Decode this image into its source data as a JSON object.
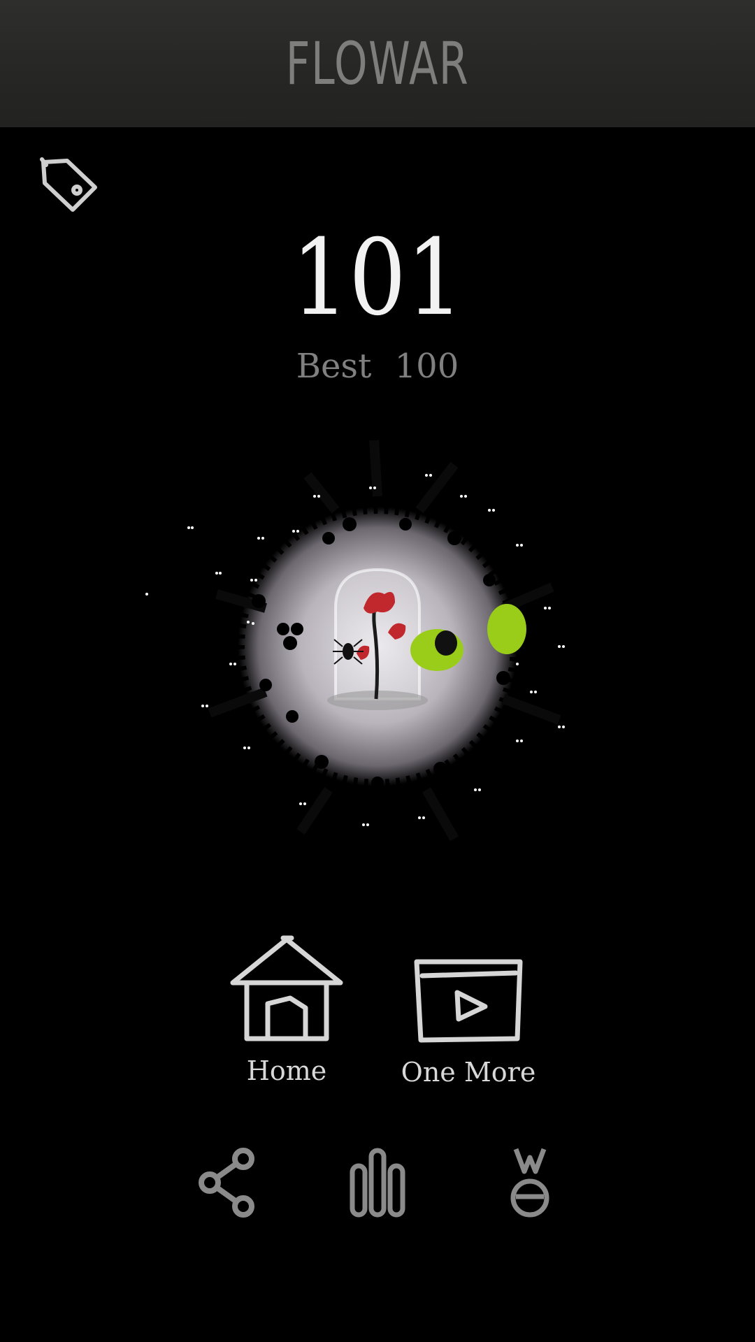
{
  "header": {
    "title": "FLOWAR"
  },
  "score": {
    "current": "101",
    "best_label": "Best",
    "best_value": "100",
    "best_text": "Best 100"
  },
  "menu": {
    "home_label": "Home",
    "one_more_label": "One More"
  },
  "icons": {
    "tag": "tag-icon",
    "home": "house-icon",
    "one_more": "video-play-icon",
    "share": "share-icon",
    "leaderboard": "bar-chart-icon",
    "achievements": "medal-icon"
  },
  "colors": {
    "background": "#000000",
    "header": "#2a2a28",
    "title": "#7e7e7c",
    "score": "#f2f2f2",
    "best": "#808080",
    "icon": "#cfcfcf",
    "bottom_icon": "#8a8a8a",
    "rose": "#c0282e",
    "slime": "#9acd1a"
  }
}
